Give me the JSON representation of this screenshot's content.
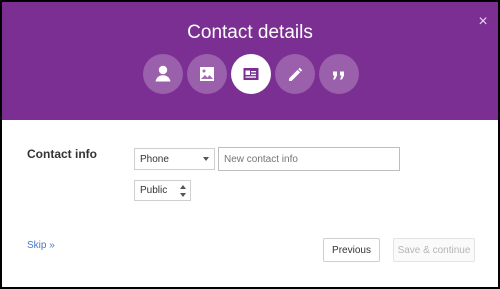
{
  "dialog": {
    "title": "Contact details",
    "close_icon": "close-icon"
  },
  "steps": [
    {
      "icon": "person-icon",
      "active": false
    },
    {
      "icon": "image-icon",
      "active": false
    },
    {
      "icon": "contact-card-icon",
      "active": true
    },
    {
      "icon": "pencil-icon",
      "active": false
    },
    {
      "icon": "quote-icon",
      "active": false
    }
  ],
  "form": {
    "section_label": "Contact info",
    "contact_type": "Phone",
    "contact_value": "",
    "contact_placeholder": "New contact info",
    "visibility": "Public"
  },
  "footer": {
    "skip_label": "Skip »",
    "previous_label": "Previous",
    "save_continue_label": "Save & continue"
  },
  "colors": {
    "header": "#7b2f93",
    "accent_link": "#4a78c8"
  }
}
